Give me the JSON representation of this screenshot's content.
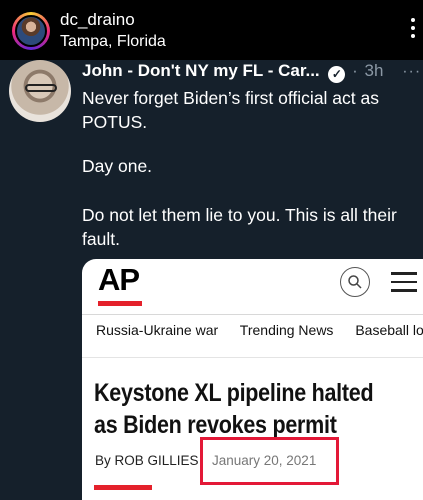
{
  "post": {
    "username": "dc_draino",
    "location": "Tampa, Florida"
  },
  "tweet": {
    "author_name": "John - Don't NY my FL - Car...",
    "time_ago": "3h",
    "dot": "·",
    "more": "···",
    "line1": "Never forget Biden’s first official act as POTUS.",
    "line2": "Day one.",
    "line3": "Do not let them lie to you. This is all their fault."
  },
  "article": {
    "publisher": "AP",
    "nav_items": [
      "Russia-Ukraine war",
      "Trending News",
      "Baseball lockout"
    ],
    "headline": "Keystone XL pipeline halted as Biden revokes permit",
    "byline": "By ROB GILLIES",
    "date": "January 20, 2021"
  },
  "colors": {
    "tweet_bg": "#15202b",
    "accent_red": "#e4212b",
    "highlight_red": "#e31837"
  },
  "icons": [
    "more-vertical-icon",
    "verified-badge-icon",
    "search-icon",
    "menu-icon"
  ]
}
